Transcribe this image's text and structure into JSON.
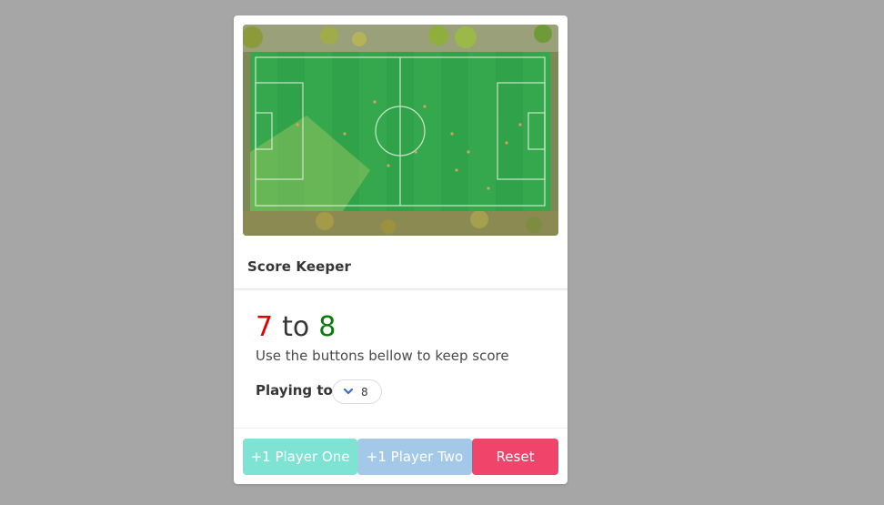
{
  "card": {
    "image_alt": "Aerial view of a soccer field",
    "title": "Score Keeper"
  },
  "score": {
    "player_one": "7",
    "separator": "to",
    "player_two": "8",
    "subtitle": "Use the buttons bellow to keep score"
  },
  "settings": {
    "playing_to_label": "Playing to:",
    "playing_to_value": "8"
  },
  "buttons": {
    "player_one": "+1 Player One",
    "player_two": "+1 Player Two",
    "reset": "Reset"
  },
  "colors": {
    "player_one": "#e00000",
    "player_two": "#0a7a0a",
    "btn_player_one": "#7fe3d4",
    "btn_player_two": "#a4c8e8",
    "btn_reset": "#f1446b"
  }
}
